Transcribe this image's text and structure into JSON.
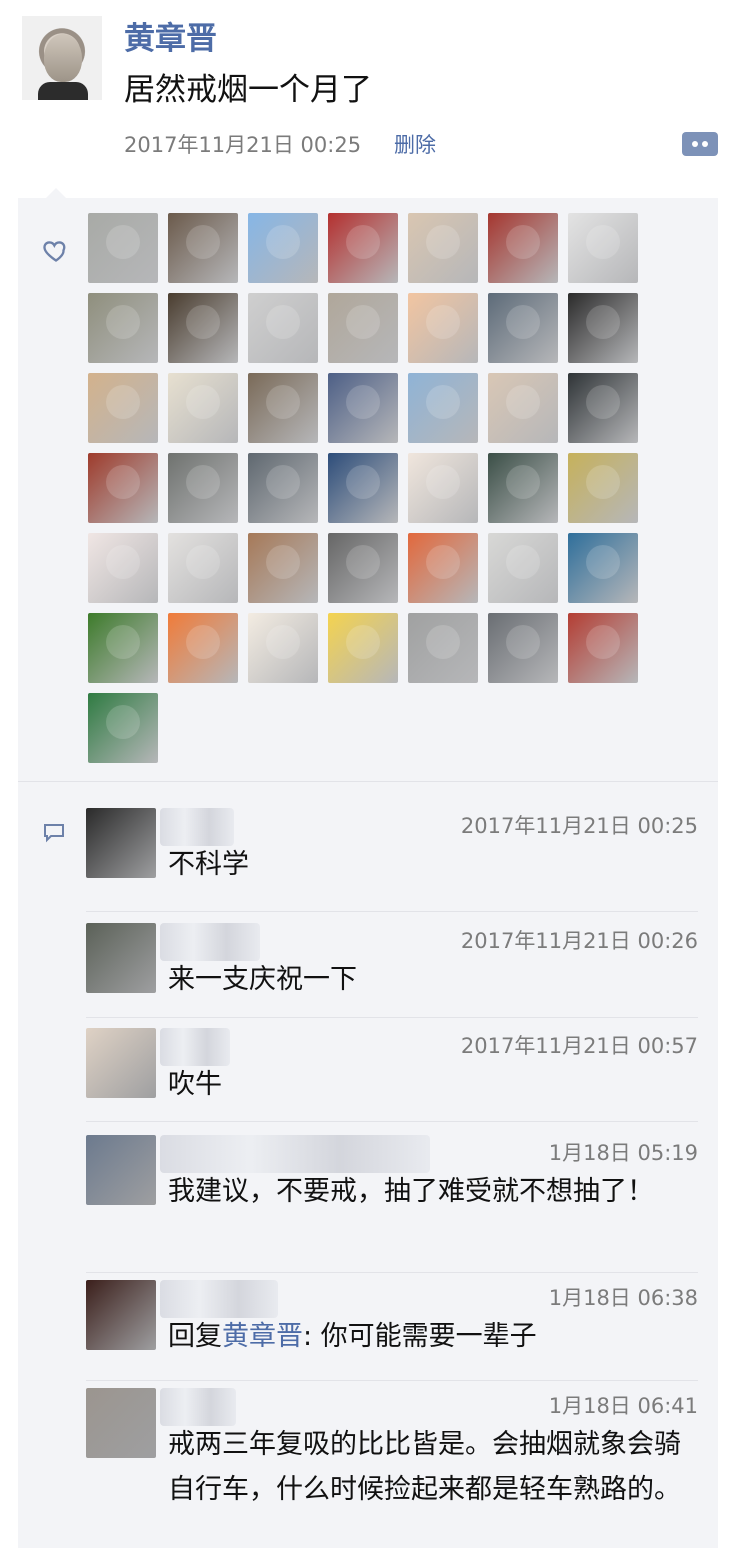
{
  "post": {
    "author": "黄章晋",
    "text": "居然戒烟一个月了",
    "time": "2017年11月21日 00:25",
    "delete_label": "删除",
    "avatar_icon": "avatar-man-icon"
  },
  "likes": {
    "icon": "heart-outline-icon",
    "avatar_colors": [
      "#a8aaa6",
      "#6b5a4b",
      "#86b6e6",
      "#b4302f",
      "#d9c6b1",
      "#a5362f",
      "#e3e3e3",
      "#8f8f7d",
      "#4a3d2f",
      "#cfcfcf",
      "#b0a79a",
      "#f2c5a1",
      "#5d6b79",
      "#2b2b2b",
      "#d3b28c",
      "#e7e0d0",
      "#7a6a58",
      "#4d5f86",
      "#8fb3d6",
      "#d9c7b5",
      "#2f3437",
      "#9e3b2c",
      "#6f726f",
      "#5f6870",
      "#2d4d7a",
      "#f0e6dd",
      "#3b4f47",
      "#c6b15b",
      "#f0e6e4",
      "#e3e1df",
      "#a67958",
      "#666666",
      "#e2683c",
      "#d8d8d6",
      "#2f6f9b",
      "#3d7b2b",
      "#f07b39",
      "#f3ece2",
      "#f4d34f",
      "#a0a1a1",
      "#6a6e73",
      "#b43d33",
      "#2f7b42"
    ]
  },
  "comments_icon": "comment-bubble-icon",
  "comments": [
    {
      "time": "2017年11月21日 00:25",
      "text": "不科学",
      "avatar": "#2a2a2a",
      "name_width": 74
    },
    {
      "time": "2017年11月21日 00:26",
      "text": "来一支庆祝一下",
      "avatar": "#5b6158",
      "name_width": 100
    },
    {
      "time": "2017年11月21日 00:57",
      "text": "吹牛",
      "avatar": "#dfd2c5",
      "name_width": 70
    },
    {
      "time": "1月18日 05:19",
      "text": "我建议，不要戒，抽了难受就不想抽了！",
      "avatar": "#6c7a8e",
      "name_width": 270
    },
    {
      "time": "1月18日 06:38",
      "reply_prefix": "回复",
      "reply_to": "黄章晋",
      "reply_text": ": 你可能需要一辈子",
      "avatar": "#3b1f1b",
      "name_width": 118
    },
    {
      "time": "1月18日 06:41",
      "text": "戒两三年复吸的比比皆是。会抽烟就象会骑自行车，什么时候捡起来都是轻车熟路的。",
      "avatar": "#9b958f",
      "name_width": 76
    }
  ]
}
